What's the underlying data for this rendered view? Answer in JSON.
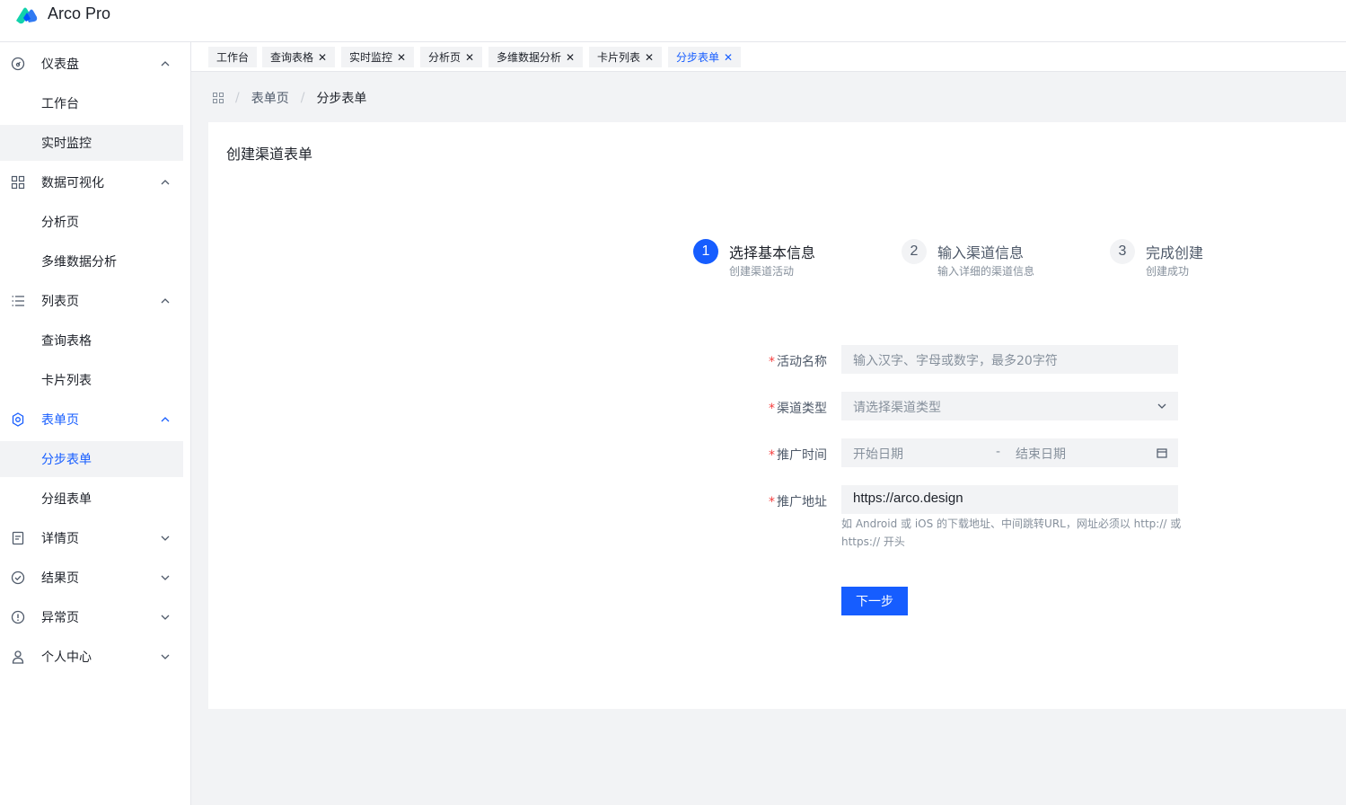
{
  "app": {
    "brand": "Arco Pro",
    "accent_color": "#165dff"
  },
  "sidebar": {
    "items": [
      {
        "label": "仪表盘",
        "icon": "dashboard-icon",
        "expanded": true
      },
      {
        "label": "工作台",
        "sub": true
      },
      {
        "label": "实时监控",
        "sub": true,
        "hover": true
      },
      {
        "label": "数据可视化",
        "icon": "grid-icon",
        "expanded": true
      },
      {
        "label": "分析页",
        "sub": true
      },
      {
        "label": "多维数据分析",
        "sub": true
      },
      {
        "label": "列表页",
        "icon": "list-icon",
        "expanded": true
      },
      {
        "label": "查询表格",
        "sub": true
      },
      {
        "label": "卡片列表",
        "sub": true
      },
      {
        "label": "表单页",
        "icon": "settings-icon",
        "expanded": true,
        "active_parent": true
      },
      {
        "label": "分步表单",
        "sub": true,
        "active": true
      },
      {
        "label": "分组表单",
        "sub": true
      },
      {
        "label": "详情页",
        "icon": "file-icon",
        "expanded": false
      },
      {
        "label": "结果页",
        "icon": "check-circle-icon",
        "expanded": false
      },
      {
        "label": "异常页",
        "icon": "exclamation-circle-icon",
        "expanded": false
      },
      {
        "label": "个人中心",
        "icon": "user-icon",
        "expanded": false
      }
    ]
  },
  "tabs": [
    {
      "label": "工作台",
      "closable": false
    },
    {
      "label": "查询表格",
      "closable": true
    },
    {
      "label": "实时监控",
      "closable": true
    },
    {
      "label": "分析页",
      "closable": true
    },
    {
      "label": "多维数据分析",
      "closable": true
    },
    {
      "label": "卡片列表",
      "closable": true
    },
    {
      "label": "分步表单",
      "closable": true,
      "active": true
    }
  ],
  "breadcrumb": {
    "items": [
      "表单页",
      "分步表单"
    ]
  },
  "card": {
    "title": "创建渠道表单"
  },
  "steps": [
    {
      "number": "1",
      "title": "选择基本信息",
      "description": "创建渠道活动",
      "active": true
    },
    {
      "number": "2",
      "title": "输入渠道信息",
      "description": "输入详细的渠道信息"
    },
    {
      "number": "3",
      "title": "完成创建",
      "description": "创建成功"
    }
  ],
  "form": {
    "name": {
      "label": "活动名称",
      "placeholder": "输入汉字、字母或数字，最多20字符"
    },
    "channel_type": {
      "label": "渠道类型",
      "placeholder": "请选择渠道类型"
    },
    "time": {
      "label": "推广时间",
      "start_placeholder": "开始日期",
      "separator": "-",
      "end_placeholder": "结束日期"
    },
    "address": {
      "label": "推广地址",
      "value": "https://arco.design",
      "help": "如 Android 或 iOS 的下载地址、中间跳转URL，网址必须以 http:// 或 https:// 开头"
    },
    "required_mark": "*",
    "next_button": "下一步"
  }
}
